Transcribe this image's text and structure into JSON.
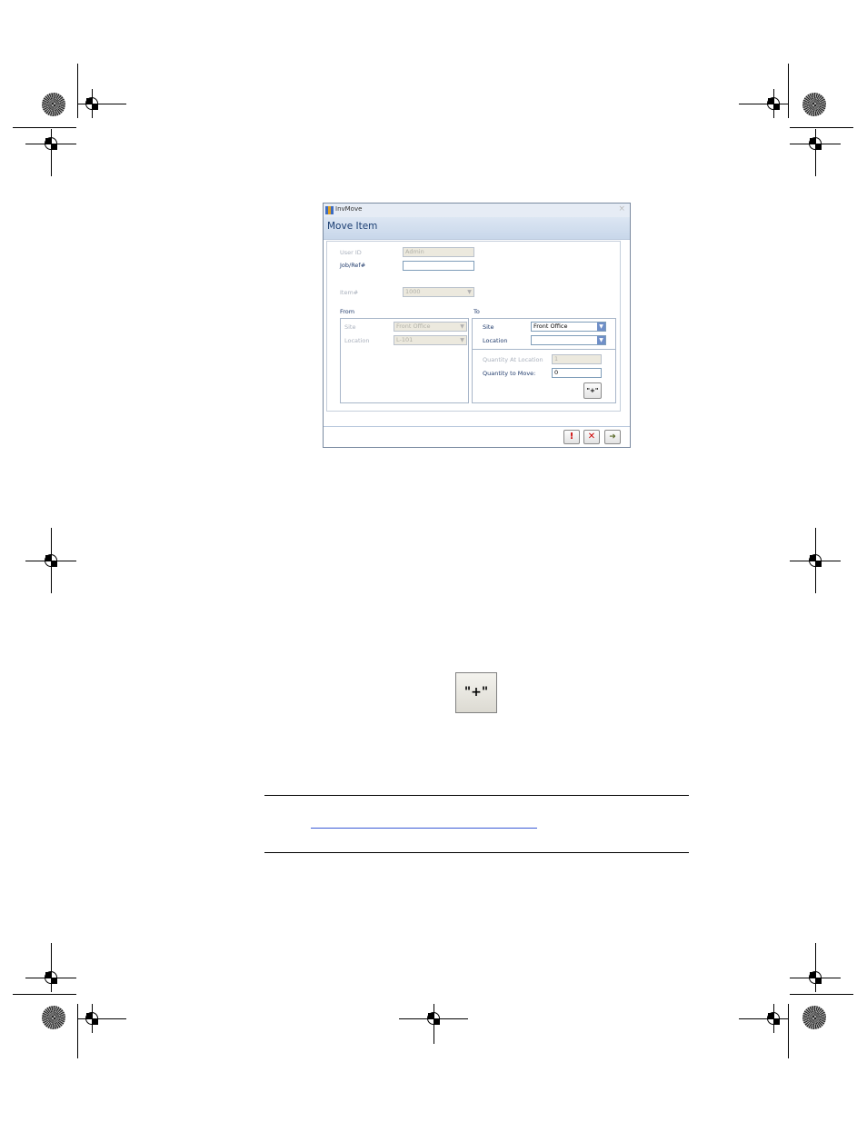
{
  "window": {
    "title": "InvMove",
    "close_glyph": "×",
    "header": "Move Item"
  },
  "form": {
    "user_id_label": "User ID",
    "user_id_value": "Admin",
    "job_ref_label": "Job/Ref#",
    "job_ref_value": "",
    "item_label": "Item#",
    "item_value": "1000"
  },
  "from": {
    "group_label": "From",
    "site_label": "Site",
    "site_value": "Front Office",
    "location_label": "Location",
    "location_value": "L-101"
  },
  "to": {
    "group_label": "To",
    "site_label": "Site",
    "site_value": "Front Office",
    "location_label": "Location",
    "location_value": "",
    "qty_at_location_label": "Quantity At Location",
    "qty_at_location_value": "1",
    "qty_to_move_label": "Quantity to Move:",
    "qty_to_move_value": "0",
    "add_button_label": "\"+\""
  },
  "footer": {
    "icons": [
      "exclamation-icon",
      "cancel-x-icon",
      "exit-door-icon"
    ],
    "exclamation_glyph": "!",
    "cancel_glyph": "✕",
    "exit_glyph": "➜"
  },
  "illustration": {
    "button_label": "\"+\""
  },
  "colors": {
    "header_text": "#1c3f73",
    "label_enabled": "#1f3a6b",
    "exclamation": "#cc0000",
    "cancel": "#cc0000"
  }
}
